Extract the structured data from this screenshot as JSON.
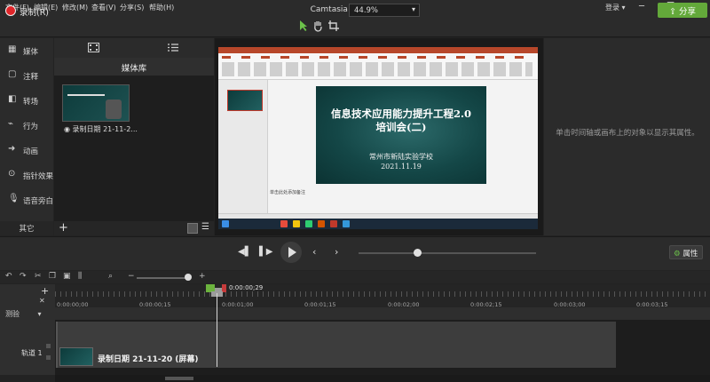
{
  "menubar": {
    "items": [
      "文件(F)",
      "编辑(E)",
      "修改(M)",
      "查看(V)",
      "分享(S)",
      "帮助(H)"
    ],
    "title": "Camtasia - 未命名项目*",
    "login": "登录"
  },
  "toolbar": {
    "record_label": "录制(R)",
    "zoom_value": "44.9%",
    "share_label": "分享",
    "share_color": "#63a93a",
    "record_color": "#e0262a"
  },
  "sidebar": {
    "items": [
      {
        "label": "媒体",
        "icon": "media-icon"
      },
      {
        "label": "注释",
        "icon": "annotation-icon"
      },
      {
        "label": "转场",
        "icon": "transition-icon"
      },
      {
        "label": "行为",
        "icon": "behavior-icon"
      },
      {
        "label": "动画",
        "icon": "animation-icon"
      },
      {
        "label": "指针效果",
        "icon": "cursor-effect-icon"
      },
      {
        "label": "语音旁白",
        "icon": "microphone-icon"
      }
    ],
    "more_label": "其它"
  },
  "media": {
    "header": "媒体库",
    "clip_label": "◉ 录制日期 21-11-2..."
  },
  "slide": {
    "title_line1": "信息技术应用能力提升工程2.0",
    "title_line2": "培训会(二)",
    "school": "常州市新陆实验学校",
    "date": "2021.11.19",
    "notes": "单击此处添加备注"
  },
  "properties": {
    "hint": "单击时间轴或画布上的对象以显示其属性。",
    "button_label": "属性"
  },
  "timeline": {
    "current_time": "0:00:00;29",
    "ticks": [
      "0:00:00;00",
      "0:00:00;15",
      "0:00:01;00",
      "0:00:01;15",
      "0:00:02;00",
      "0:00:02;15",
      "0:00:03;00",
      "0:00:03;15"
    ],
    "marker_label": "测验",
    "track_label": "轨道 1",
    "clip_label": "录制日期 21-11-20 (屏幕)"
  }
}
